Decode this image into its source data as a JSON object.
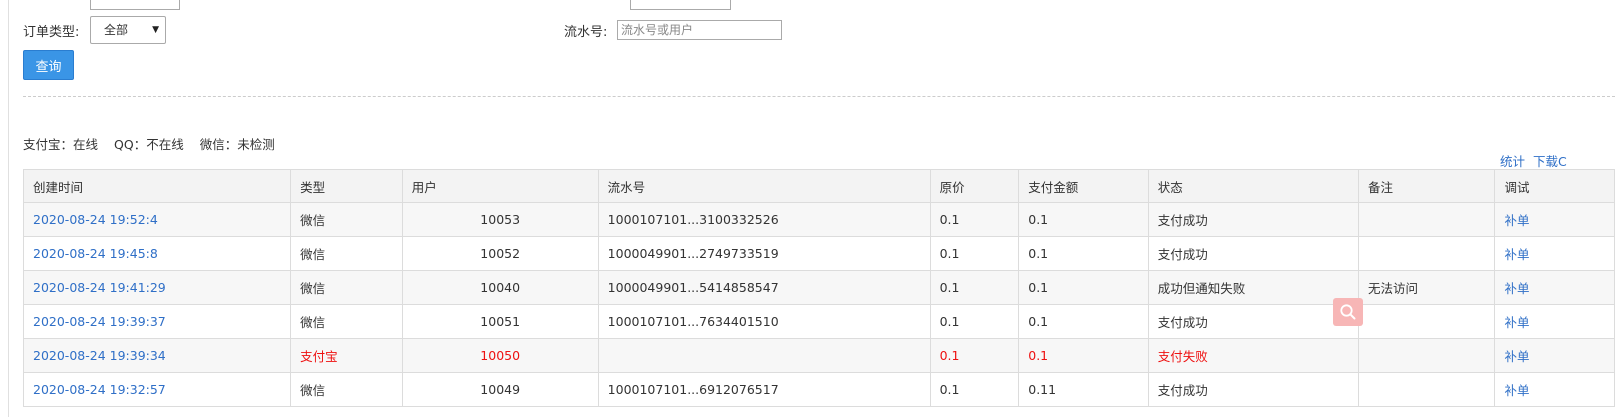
{
  "filters": {
    "order_type_label": "订单类型:",
    "order_type_value": "全部",
    "serial_label": "流水号:",
    "serial_placeholder": "流水号或用户",
    "query_button": "查询"
  },
  "status": {
    "alipay": "支付宝：在线",
    "qq": "QQ：不在线",
    "wechat": "微信：未检测"
  },
  "toolbar": {
    "stats_link": "统计",
    "download_link": "下载C"
  },
  "table": {
    "headers": [
      "创建时间",
      "类型",
      "用户",
      "流水号",
      "原价",
      "支付金额",
      "状态",
      "备注",
      "调试"
    ],
    "rows": [
      {
        "time": "2020-08-24 19:52:4",
        "type": "微信",
        "user": "10053",
        "serial": "1000107101...3100332526",
        "price": "0.1",
        "paid": "0.1",
        "status": "支付成功",
        "note": "",
        "action": "补单"
      },
      {
        "time": "2020-08-24 19:45:8",
        "type": "微信",
        "user": "10052",
        "serial": "1000049901...2749733519",
        "price": "0.1",
        "paid": "0.1",
        "status": "支付成功",
        "note": "",
        "action": "补单"
      },
      {
        "time": "2020-08-24 19:41:29",
        "type": "微信",
        "user": "10040",
        "serial": "1000049901...5414858547",
        "price": "0.1",
        "paid": "0.1",
        "status": "成功但通知失败",
        "note": "无法访问",
        "action": "补单"
      },
      {
        "time": "2020-08-24 19:39:37",
        "type": "微信",
        "user": "10051",
        "serial": "1000107101...7634401510",
        "price": "0.1",
        "paid": "0.1",
        "status": "支付成功",
        "note": "",
        "action": "补单"
      },
      {
        "time": "2020-08-24 19:39:34",
        "type": "支付宝",
        "user": "10050",
        "serial": "",
        "price": "0.1",
        "paid": "0.1",
        "status": "支付失败",
        "note": "",
        "action": "补单"
      },
      {
        "time": "2020-08-24 19:32:57",
        "type": "微信",
        "user": "10049",
        "serial": "1000107101...6912076517",
        "price": "0.1",
        "paid": "0.11",
        "status": "支付成功",
        "note": "",
        "action": "补单"
      }
    ]
  },
  "colors": {
    "link": "#2f6fc7",
    "error": "#ee1111",
    "button": "#3a95e6"
  },
  "icons": {
    "floating_search": "magnifier-icon"
  }
}
